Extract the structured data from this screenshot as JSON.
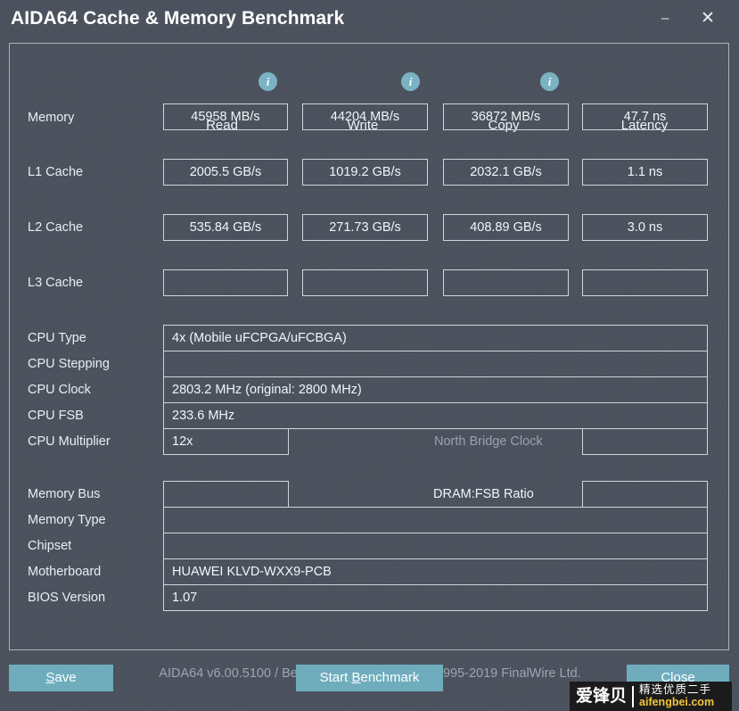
{
  "window": {
    "title": "AIDA64 Cache & Memory Benchmark",
    "minimize_glyph": "–",
    "close_glyph": "✕"
  },
  "benchmark_table": {
    "columns": [
      {
        "label": "Read",
        "has_info_icon": true,
        "info_glyph": "i"
      },
      {
        "label": "Write",
        "has_info_icon": true,
        "info_glyph": "i"
      },
      {
        "label": "Copy",
        "has_info_icon": true,
        "info_glyph": "i"
      },
      {
        "label": "Latency",
        "has_info_icon": false,
        "info_glyph": ""
      }
    ],
    "rows": [
      {
        "label": "Memory",
        "read": "45958 MB/s",
        "write": "44204 MB/s",
        "copy": "36872 MB/s",
        "latency": "47.7 ns"
      },
      {
        "label": "L1 Cache",
        "read": "2005.5 GB/s",
        "write": "1019.2 GB/s",
        "copy": "2032.1 GB/s",
        "latency": "1.1 ns"
      },
      {
        "label": "L2 Cache",
        "read": "535.84 GB/s",
        "write": "271.73 GB/s",
        "copy": "408.89 GB/s",
        "latency": "3.0 ns"
      },
      {
        "label": "L3 Cache",
        "read": "",
        "write": "",
        "copy": "",
        "latency": ""
      }
    ]
  },
  "cpu_info": {
    "cpu_type_label": "CPU Type",
    "cpu_type_value": "4x   (Mobile uFCPGA/uFCBGA)",
    "cpu_stepping_label": "CPU Stepping",
    "cpu_stepping_value": "",
    "cpu_clock_label": "CPU Clock",
    "cpu_clock_value": "2803.2 MHz  (original: 2800 MHz)",
    "cpu_fsb_label": "CPU FSB",
    "cpu_fsb_value": "233.6 MHz",
    "cpu_multiplier_label": "CPU Multiplier",
    "cpu_multiplier_value": "12x",
    "north_bridge_clock_label": "North Bridge Clock",
    "north_bridge_clock_value": ""
  },
  "memory_info": {
    "memory_bus_label": "Memory Bus",
    "memory_bus_value": "",
    "dram_fsb_ratio_label": "DRAM:FSB Ratio",
    "dram_fsb_ratio_value": "",
    "memory_type_label": "Memory Type",
    "memory_type_value": "",
    "chipset_label": "Chipset",
    "chipset_value": "",
    "motherboard_label": "Motherboard",
    "motherboard_value": "HUAWEI KLVD-WXX9-PCB",
    "bios_version_label": "BIOS Version",
    "bios_version_value": "1.07"
  },
  "footer": {
    "version_text": "AIDA64 v6.00.5100 / BenchDLL 4.4.800-x64  (c) 1995-2019 FinalWire Ltd."
  },
  "buttons": {
    "save": {
      "pre": "",
      "accel": "S",
      "post": "ave"
    },
    "start_benchmark": {
      "pre": "Start ",
      "accel": "B",
      "post": "enchmark"
    },
    "close": {
      "pre": "Close",
      "accel": "",
      "post": ""
    }
  },
  "watermark": {
    "brand_cn": "爱锋贝",
    "tagline_cn": "精选优质二手",
    "url": "aifengbei.com"
  },
  "colors": {
    "window_background": "#4b525d",
    "field_border": "#cfd6dc",
    "panel_border": "#a9b2bb",
    "button_accent": "#6fadbd",
    "info_icon": "#7bb3c4",
    "text_primary": "#f1f5f8",
    "text_dim": "#97a3ae",
    "watermark_url": "#f2c53d"
  }
}
